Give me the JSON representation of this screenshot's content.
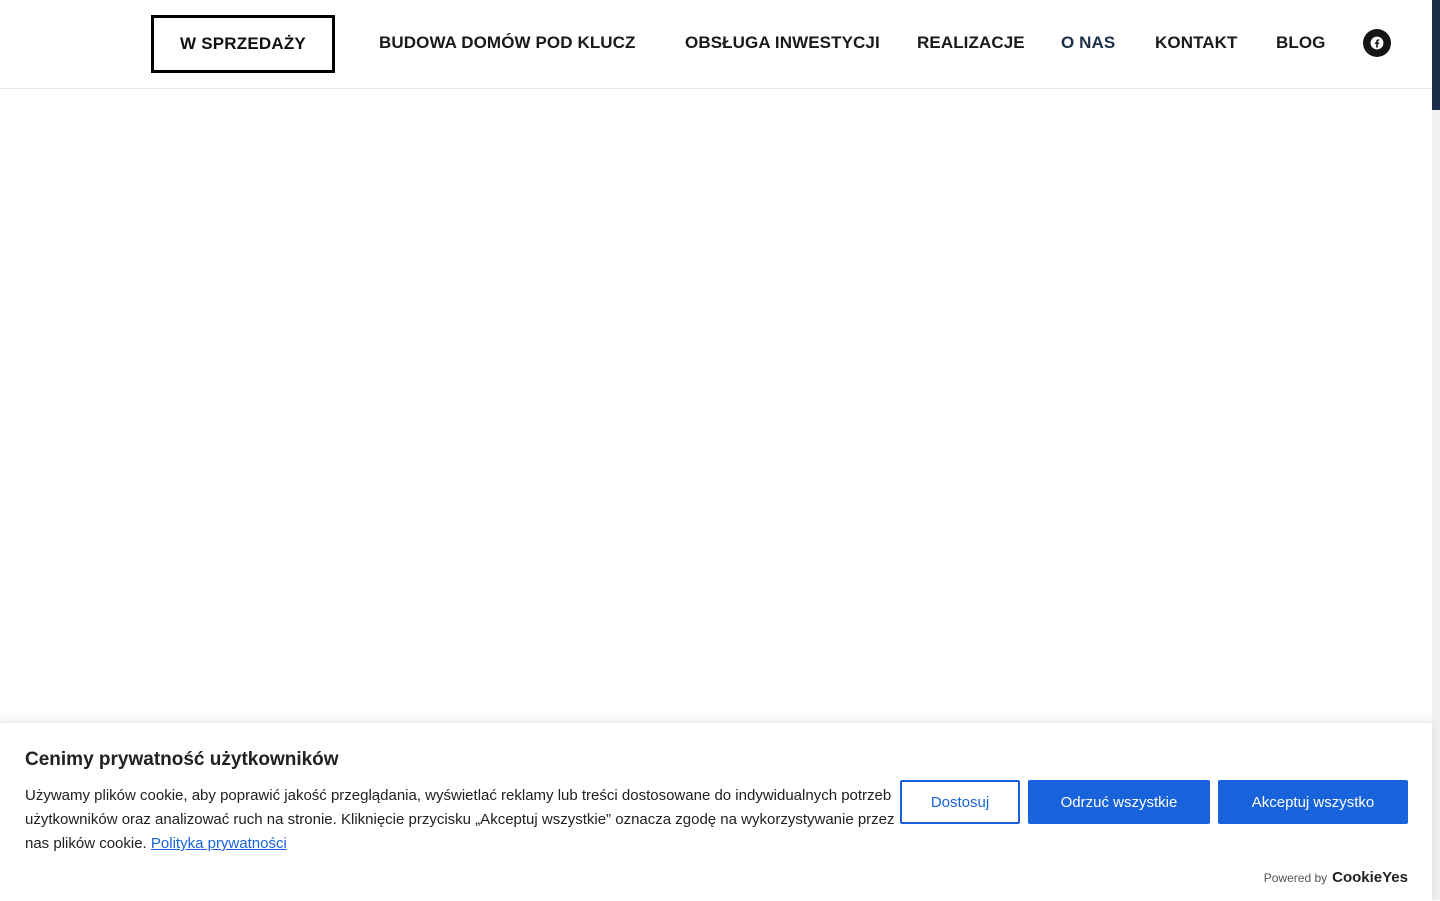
{
  "nav": {
    "cta_label": "W SPRZEDAŻY",
    "items": [
      {
        "label": "BUDOWA DOMÓW POD KLUCZ"
      },
      {
        "label": "OBSŁUGA INWESTYCJI"
      },
      {
        "label": "REALIZACJE"
      },
      {
        "label": "O NAS",
        "active": true
      },
      {
        "label": "KONTAKT"
      },
      {
        "label": "BLOG"
      }
    ],
    "social_icon": "facebook-icon",
    "active_color": "#1c2f4a"
  },
  "cookie_banner": {
    "title": "Cenimy prywatność użytkowników",
    "text": "Używamy plików cookie, aby poprawić jakość przeglądania, wyświetlać reklamy lub treści dostosowane do indywidualnych potrzeb użytkowników oraz analizować ruch na stronie. Kliknięcie przycisku „Akceptuj wszystkie” oznacza zgodę na wykorzystywanie przez nas plików cookie.",
    "policy_link": "Polityka prywatności",
    "buttons": {
      "customize": "Dostosuj",
      "reject": "Odrzuć wszystkie",
      "accept": "Akceptuj wszystko"
    },
    "powered_by_label": "Powered by",
    "powered_by_brand": "CookieYes",
    "accent_color": "#1863dc"
  }
}
